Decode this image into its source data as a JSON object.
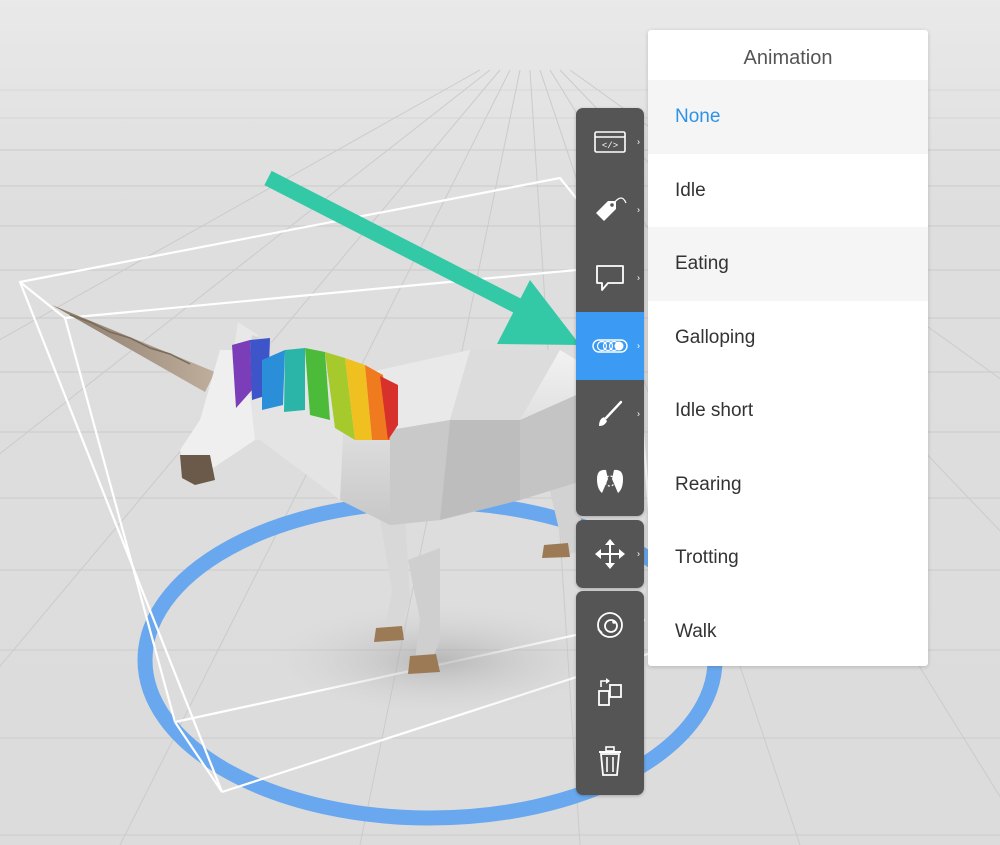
{
  "colors": {
    "accent": "#3b9bf4",
    "toolbar_bg": "#555555",
    "selected_text": "#2e93e8",
    "arrow": "#33c9a6",
    "ground_ring": "#69a8ee"
  },
  "toolbar": {
    "groups": [
      [
        {
          "icon": "code-icon",
          "has_chevron": true
        },
        {
          "icon": "tag-icon",
          "has_chevron": true
        },
        {
          "icon": "comment-icon",
          "has_chevron": true
        },
        {
          "icon": "animation-icon",
          "has_chevron": true,
          "active": true
        },
        {
          "icon": "brush-icon",
          "has_chevron": true
        },
        {
          "icon": "physics-icon",
          "has_chevron": false
        }
      ],
      [
        {
          "icon": "move-icon",
          "has_chevron": true
        }
      ],
      [
        {
          "icon": "rotate-icon",
          "has_chevron": false
        },
        {
          "icon": "duplicate-icon",
          "has_chevron": false
        },
        {
          "icon": "trash-icon",
          "has_chevron": false
        }
      ]
    ]
  },
  "menu": {
    "title": "Animation",
    "selected_index": 0,
    "items": [
      "None",
      "Idle",
      "Eating",
      "Galloping",
      "Idle short",
      "Rearing",
      "Trotting",
      "Walk"
    ]
  }
}
